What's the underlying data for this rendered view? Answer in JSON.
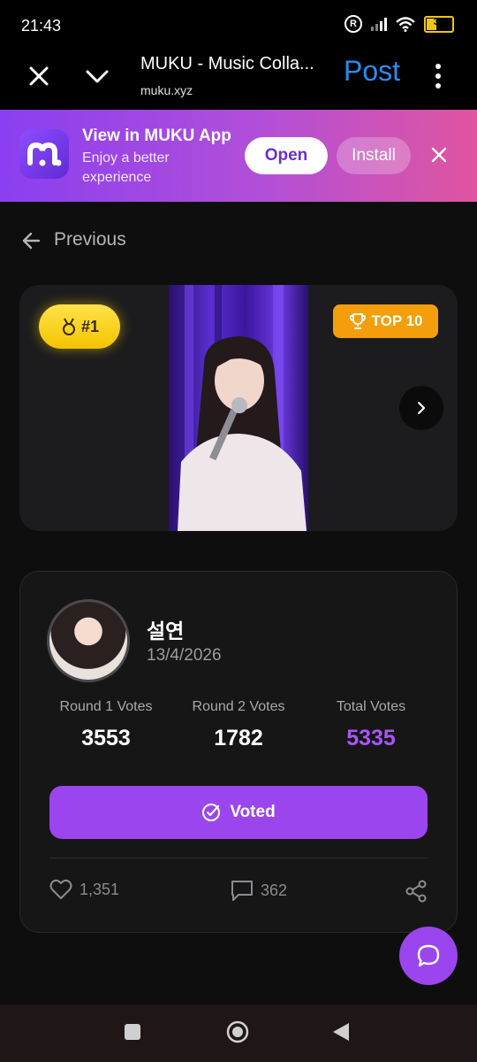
{
  "status": {
    "time": "21:43",
    "battery": "35"
  },
  "browser": {
    "title": "MUKU - Music Colla...",
    "url": "muku.xyz",
    "post_label": "Post"
  },
  "banner": {
    "title": "View in MUKU App",
    "subtitle": "Enjoy a better experience",
    "open_label": "Open",
    "install_label": "Install"
  },
  "nav": {
    "previous_label": "Previous"
  },
  "media": {
    "rank_label": "#1",
    "top_label": "TOP 10"
  },
  "entry": {
    "artist": "설연",
    "date": "13/4/2026",
    "stats": [
      {
        "label": "Round 1 Votes",
        "value": "3553",
        "color": "#ffffff"
      },
      {
        "label": "Round 2 Votes",
        "value": "1782",
        "color": "#ffffff"
      },
      {
        "label": "Total Votes",
        "value": "5335",
        "color": "#a855f7"
      }
    ],
    "voted_label": "Voted",
    "likes": "1,351",
    "comments": "362"
  },
  "colors": {
    "accent": "#9b45ee",
    "brand_blue": "#2b8cf0",
    "gold": "#f5c400",
    "orange": "#f59e0b"
  }
}
